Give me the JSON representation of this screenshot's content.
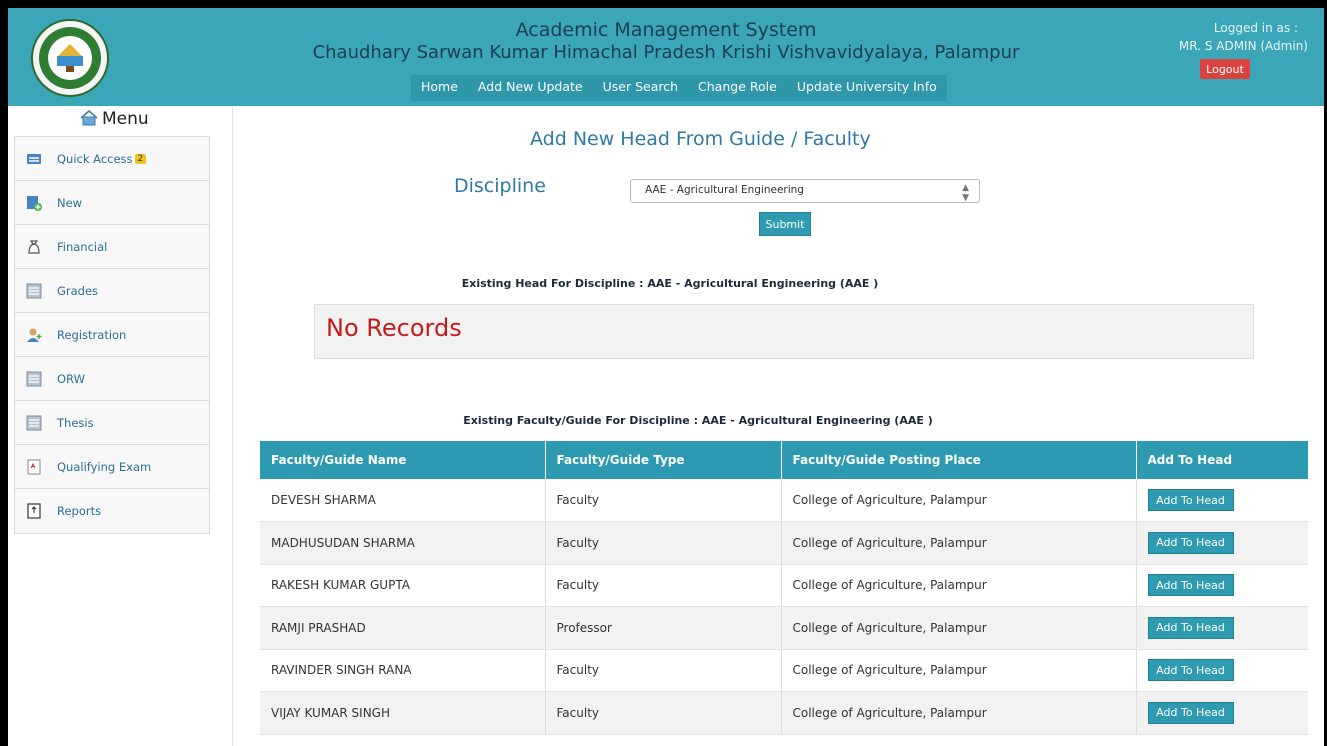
{
  "header": {
    "title": "Academic Management System",
    "subtitle": "Chaudhary Sarwan Kumar Himachal Pradesh Krishi Vishvavidyalaya, Palampur",
    "nav": [
      "Home",
      "Add New Update",
      "User Search",
      "Change Role",
      "Update University Info"
    ],
    "logged_in_label": "Logged in as :",
    "user": "MR. S ADMIN (Admin)",
    "logout_label": "Logout",
    "color": "#3aa6b8"
  },
  "sidebar": {
    "title": "Menu",
    "items": [
      {
        "label": "Quick Access",
        "badge": "2",
        "icon": "keyboard-icon"
      },
      {
        "label": "New",
        "icon": "new-document-icon"
      },
      {
        "label": "Financial",
        "icon": "money-bag-icon"
      },
      {
        "label": "Grades",
        "icon": "grid-icon"
      },
      {
        "label": "Registration",
        "icon": "user-add-icon"
      },
      {
        "label": "ORW",
        "icon": "grid-icon"
      },
      {
        "label": "Thesis",
        "icon": "grid-icon"
      },
      {
        "label": "Qualifying Exam",
        "icon": "exam-icon"
      },
      {
        "label": "Reports",
        "icon": "report-icon"
      }
    ]
  },
  "main": {
    "title": "Add New Head From Guide / Faculty",
    "discipline_label": "Discipline",
    "discipline_value": "AAE - Agricultural Engineering",
    "submit_label": "Submit",
    "existing_head_heading": "Existing Head For Discipline : AAE - Agricultural Engineering (AAE )",
    "no_records": "No Records",
    "existing_faculty_heading": "Existing Faculty/Guide For Discipline : AAE - Agricultural Engineering (AAE )"
  },
  "table": {
    "columns": [
      "Faculty/Guide Name",
      "Faculty/Guide Type",
      "Faculty/Guide Posting Place",
      "Add To Head"
    ],
    "rows": [
      {
        "name": "DEVESH SHARMA",
        "type": "Faculty",
        "place": "College of Agriculture, Palampur",
        "action": "Add To Head"
      },
      {
        "name": "MADHUSUDAN SHARMA",
        "type": "Faculty",
        "place": "College of Agriculture, Palampur",
        "action": "Add To Head"
      },
      {
        "name": "RAKESH KUMAR GUPTA",
        "type": "Faculty",
        "place": "College of Agriculture, Palampur",
        "action": "Add To Head"
      },
      {
        "name": "RAMJI PRASHAD",
        "type": "Professor",
        "place": "College of Agriculture, Palampur",
        "action": "Add To Head"
      },
      {
        "name": "RAVINDER SINGH RANA",
        "type": "Faculty",
        "place": "College of Agriculture, Palampur",
        "action": "Add To Head"
      },
      {
        "name": "VIJAY KUMAR SINGH",
        "type": "Faculty",
        "place": "College of Agriculture, Palampur",
        "action": "Add To Head"
      }
    ]
  }
}
